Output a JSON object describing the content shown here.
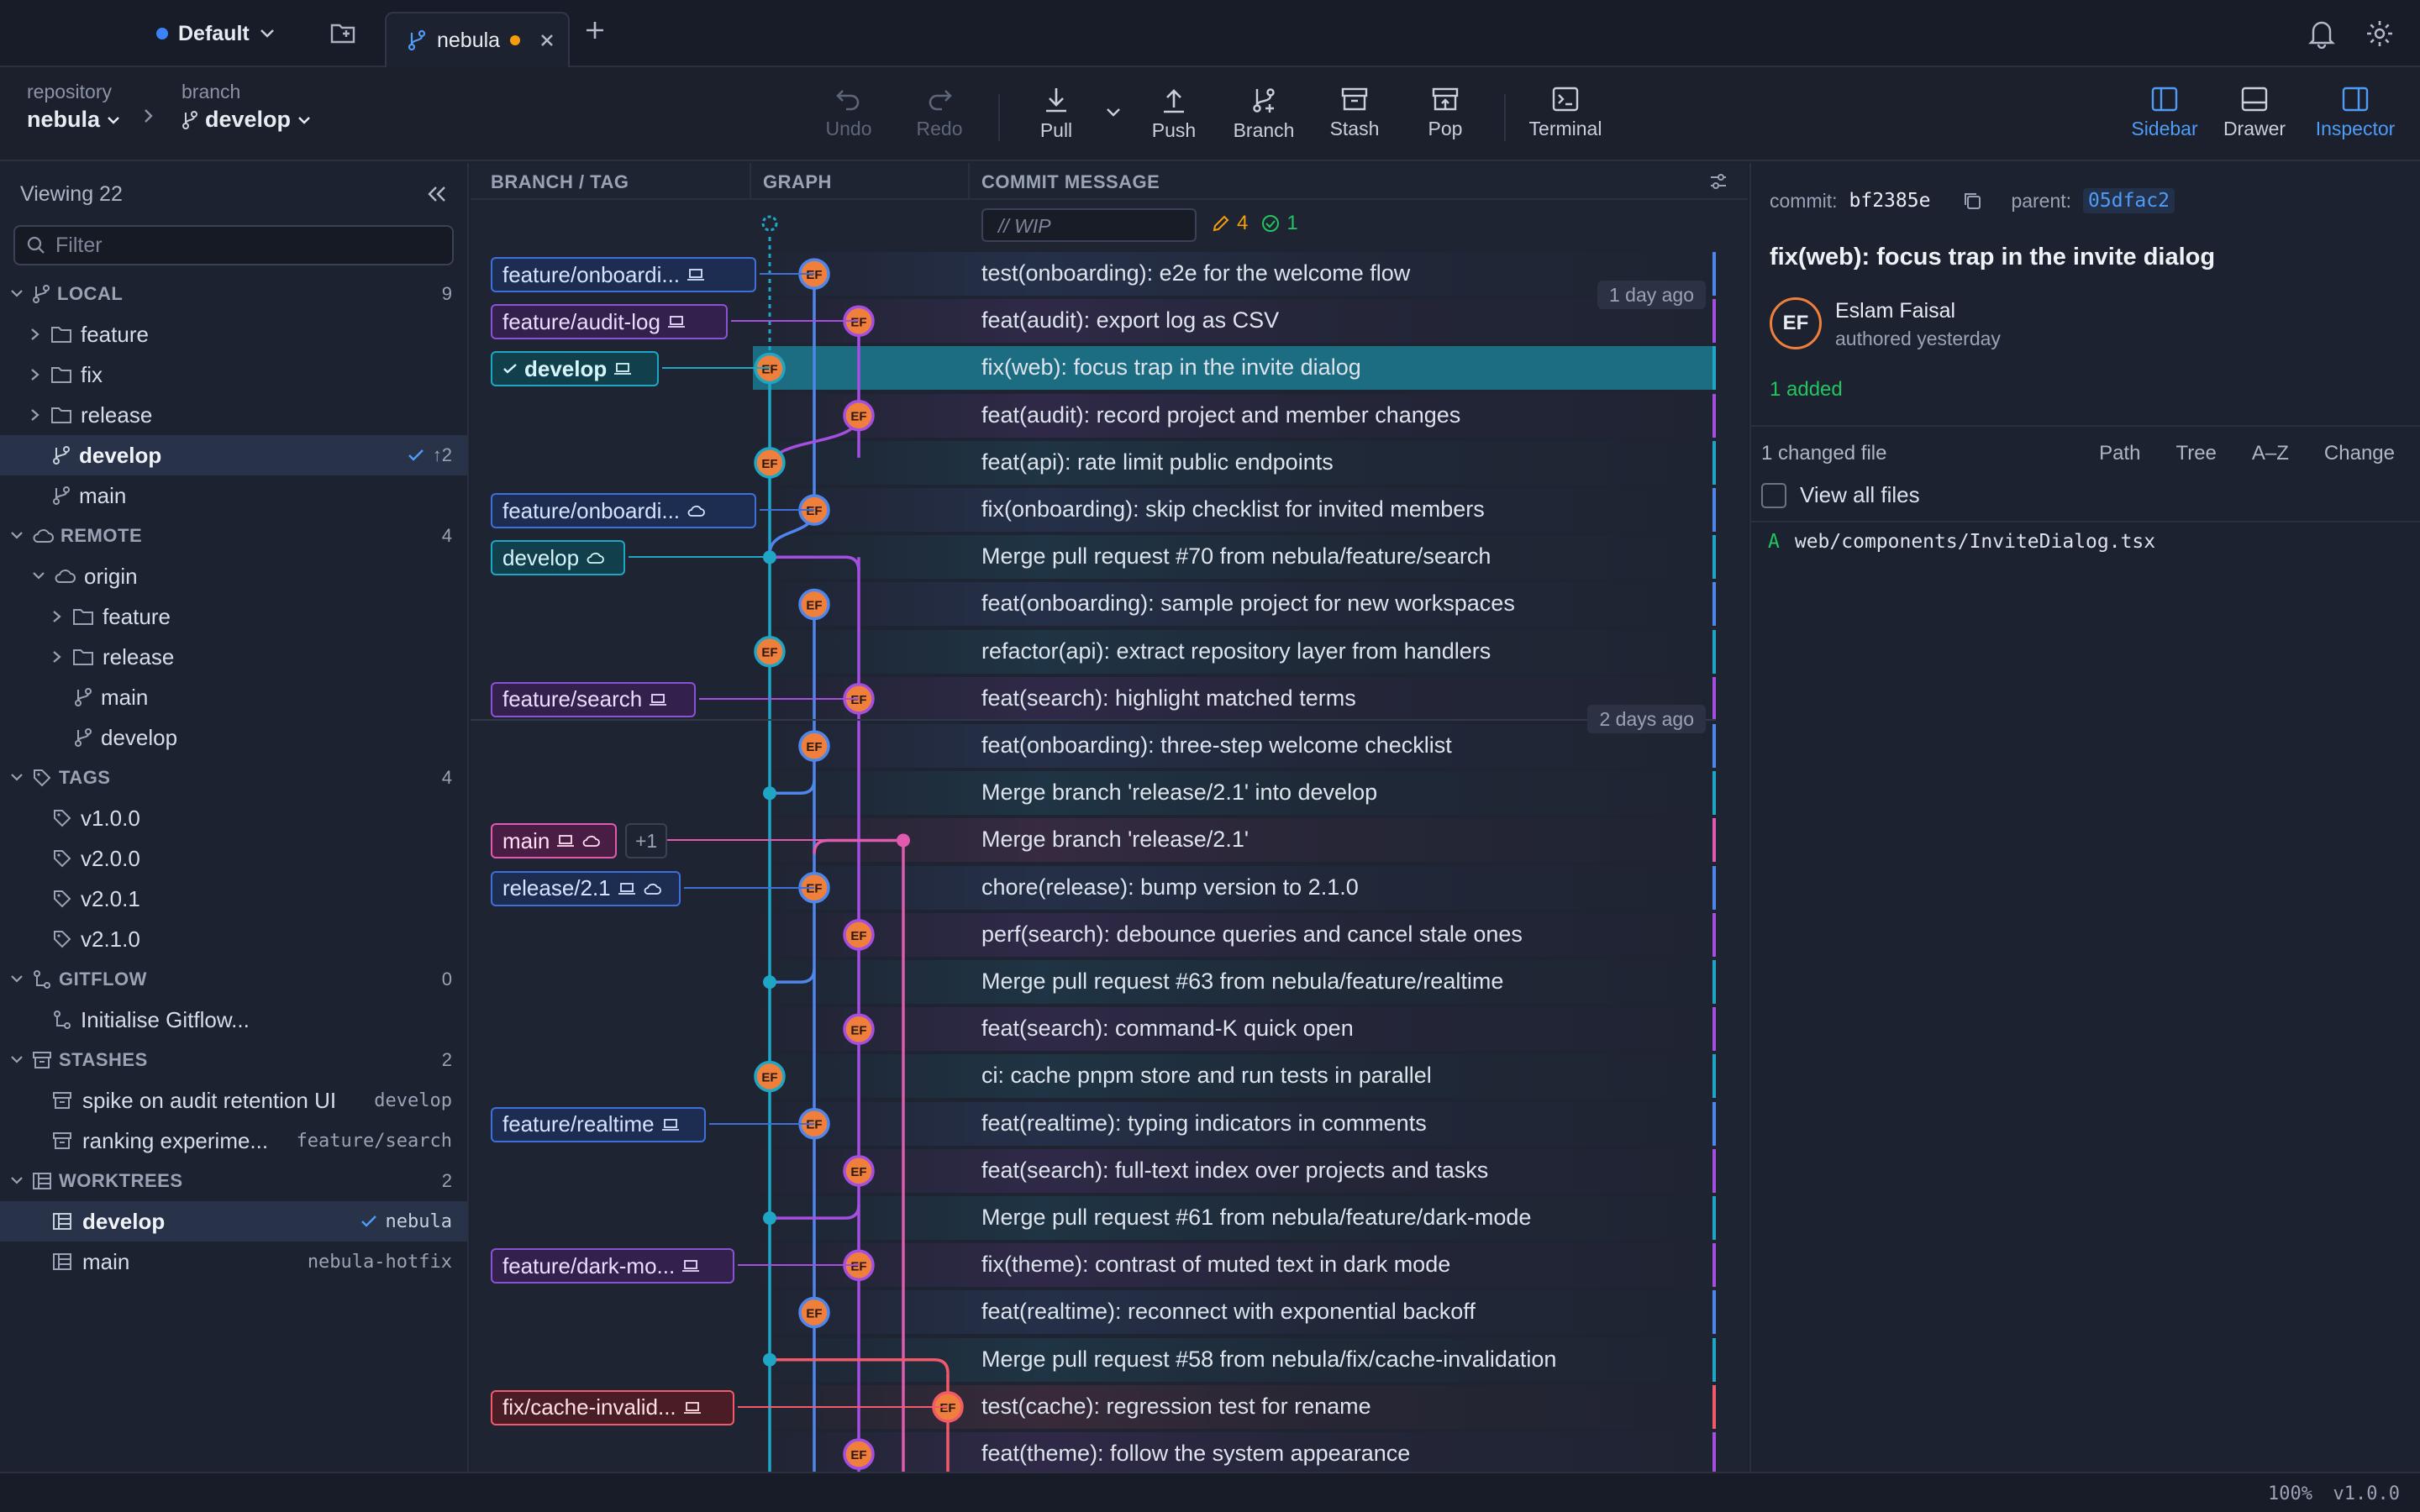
{
  "workspace": {
    "name": "Default"
  },
  "tab": {
    "name": "nebula"
  },
  "breadcrumb": {
    "repo_label": "repository",
    "repo_value": "nebula",
    "branch_label": "branch",
    "branch_value": "develop"
  },
  "toolbar": {
    "undo": "Undo",
    "redo": "Redo",
    "pull": "Pull",
    "push": "Push",
    "branch": "Branch",
    "stash": "Stash",
    "pop": "Pop",
    "terminal": "Terminal",
    "sidebar": "Sidebar",
    "drawer": "Drawer",
    "inspector": "Inspector"
  },
  "sidebar": {
    "viewing": "Viewing 22",
    "filter_placeholder": "Filter",
    "local": {
      "title": "LOCAL",
      "count": "9",
      "folders": [
        "feature",
        "fix",
        "release"
      ],
      "develop": "develop",
      "develop_meta": "↑2",
      "main": "main"
    },
    "remote": {
      "title": "REMOTE",
      "count": "4",
      "origin": "origin",
      "feature": "feature",
      "release": "release",
      "main": "main",
      "develop": "develop"
    },
    "tags": {
      "title": "TAGS",
      "count": "4",
      "items": [
        "v1.0.0",
        "v2.0.0",
        "v2.0.1",
        "v2.1.0"
      ]
    },
    "gitflow": {
      "title": "GITFLOW",
      "count": "0",
      "init": "Initialise Gitflow..."
    },
    "stashes": {
      "title": "STASHES",
      "count": "2",
      "items": [
        {
          "name": "spike on audit retention UI",
          "branch": "develop"
        },
        {
          "name": "ranking experime...",
          "branch": "feature/search"
        }
      ]
    },
    "worktrees": {
      "title": "WORKTREES",
      "count": "2",
      "items": [
        {
          "name": "develop",
          "repo": "nebula"
        },
        {
          "name": "main",
          "repo": "nebula-hotfix"
        }
      ]
    }
  },
  "graph": {
    "headers": {
      "branch": "BRANCH / TAG",
      "graph": "GRAPH",
      "message": "COMMIT MESSAGE"
    },
    "wip": {
      "text": "// WIP",
      "edits": "4",
      "adds": "1"
    },
    "date_markers": [
      "1 day ago",
      "2 days ago"
    ],
    "avatar_initials": "EF",
    "plus_badge": "+1",
    "labels": [
      "feature/onboardi...",
      "feature/audit-log",
      "develop",
      "feature/onboardi...",
      "develop",
      "feature/search",
      "main",
      "release/2.1",
      "feature/realtime",
      "feature/dark-mo...",
      "fix/cache-invalid..."
    ],
    "commits": [
      "test(onboarding): e2e for the welcome flow",
      "feat(audit): export log as CSV",
      "fix(web): focus trap in the invite dialog",
      "feat(audit): record project and member changes",
      "feat(api): rate limit public endpoints",
      "fix(onboarding): skip checklist for invited members",
      "Merge pull request #70 from nebula/feature/search",
      "feat(onboarding): sample project for new workspaces",
      "refactor(api): extract repository layer from handlers",
      "feat(search): highlight matched terms",
      "feat(onboarding): three-step welcome checklist",
      "Merge branch 'release/2.1' into develop",
      "Merge branch 'release/2.1'",
      "chore(release): bump version to 2.1.0",
      "perf(search): debounce queries and cancel stale ones",
      "Merge pull request #63 from nebula/feature/realtime",
      "feat(search): command-K quick open",
      "ci: cache pnpm store and run tests in parallel",
      "feat(realtime): typing indicators in comments",
      "feat(search): full-text index over projects and tasks",
      "Merge pull request #61 from nebula/feature/dark-mode",
      "fix(theme): contrast of muted text in dark mode",
      "feat(realtime): reconnect with exponential backoff",
      "Merge pull request #58 from nebula/fix/cache-invalidation",
      "test(cache): regression test for rename",
      "feat(theme): follow the system appearance"
    ]
  },
  "inspector": {
    "commit_label": "commit:",
    "commit_hash": "bf2385e",
    "parent_label": "parent:",
    "parent_hash": "05dfac2",
    "title": "fix(web): focus trap in the invite dialog",
    "author": "Eslam Faisal",
    "initials": "EF",
    "authored": "authored yesterday",
    "summary": "1 added",
    "changed": "1 changed file",
    "views": [
      "Path",
      "Tree",
      "A–Z",
      "Change"
    ],
    "view_all": "View all files",
    "file_status": "A",
    "file_path": "web/components/InviteDialog.tsx"
  },
  "status": {
    "zoom": "100%",
    "version": "v1.0.0"
  }
}
